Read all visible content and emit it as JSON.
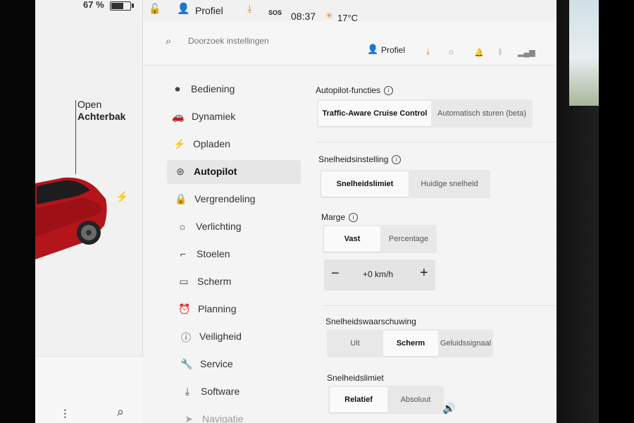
{
  "status": {
    "battery_percent": "67 %",
    "battery_level": 0.67,
    "profile": "Profiel",
    "sos": "SOS",
    "time": "08:37",
    "temperature": "17°C"
  },
  "car_panel": {
    "trunk_line1": "Open",
    "trunk_line2": "Achterbak"
  },
  "search": {
    "placeholder": "Doorzoek instellingen",
    "profile": "Profiel"
  },
  "nav": {
    "items": [
      {
        "label": "Bediening",
        "icon": "toggle-icon"
      },
      {
        "label": "Dynamiek",
        "icon": "car-icon"
      },
      {
        "label": "Opladen",
        "icon": "bolt-icon"
      },
      {
        "label": "Autopilot",
        "icon": "steering-wheel-icon"
      },
      {
        "label": "Vergrendeling",
        "icon": "lock-icon"
      },
      {
        "label": "Verlichting",
        "icon": "light-icon"
      },
      {
        "label": "Stoelen",
        "icon": "seat-icon"
      },
      {
        "label": "Scherm",
        "icon": "screen-icon"
      },
      {
        "label": "Planning",
        "icon": "alarm-clock-icon"
      },
      {
        "label": "Veiligheid",
        "icon": "alert-icon"
      },
      {
        "label": "Service",
        "icon": "wrench-icon"
      },
      {
        "label": "Software",
        "icon": "download-icon"
      },
      {
        "label": "Navigatie",
        "icon": "navigation-icon"
      }
    ],
    "active": "Autopilot"
  },
  "autopilot": {
    "functions_title": "Autopilot-functies",
    "functions_options": [
      "Traffic-Aware Cruise Control",
      "Automatisch sturen (beta)"
    ],
    "functions_selected": "Traffic-Aware Cruise Control",
    "speed_setting_title": "Snelheidsinstelling",
    "speed_setting_options": [
      "Snelheidslimiet",
      "Huidige snelheid"
    ],
    "speed_setting_selected": "Snelheidslimiet",
    "margin_title": "Marge",
    "margin_options": [
      "Vast",
      "Percentage"
    ],
    "margin_selected": "Vast",
    "margin_value": "+0 km/h",
    "warning_title": "Snelheidswaarschuwing",
    "warning_options": [
      "Uit",
      "Scherm",
      "Geluidssignaal"
    ],
    "warning_selected": "Scherm",
    "limit_title": "Snelheidslimiet",
    "limit_options": [
      "Relatief",
      "Absoluut"
    ],
    "limit_selected": "Relatief"
  },
  "colors": {
    "accent_orange": "#e08a1e",
    "car_red": "#b3151b",
    "selected_bg": "#fafafa",
    "segment_bg": "#e8e8e8"
  }
}
